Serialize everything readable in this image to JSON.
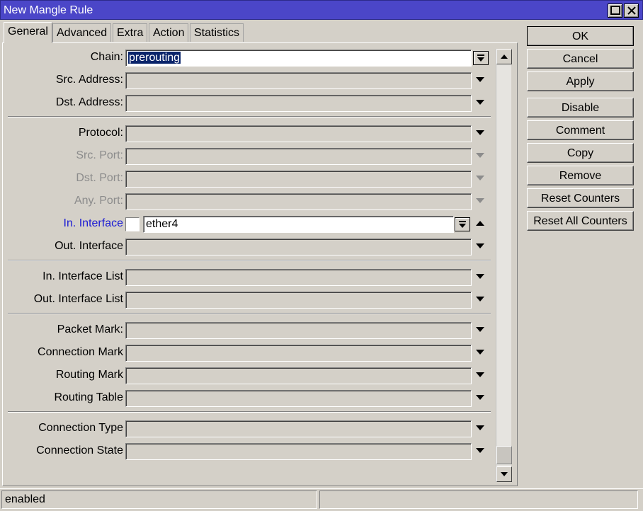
{
  "window": {
    "title": "New Mangle Rule"
  },
  "tabs": [
    {
      "label": "General",
      "active": true
    },
    {
      "label": "Advanced"
    },
    {
      "label": "Extra"
    },
    {
      "label": "Action"
    },
    {
      "label": "Statistics"
    }
  ],
  "fields": {
    "chain": {
      "label": "Chain:",
      "value": "prerouting"
    },
    "src_address": {
      "label": "Src. Address:",
      "value": ""
    },
    "dst_address": {
      "label": "Dst. Address:",
      "value": ""
    },
    "protocol": {
      "label": "Protocol:",
      "value": ""
    },
    "src_port": {
      "label": "Src. Port:",
      "value": ""
    },
    "dst_port": {
      "label": "Dst. Port:",
      "value": ""
    },
    "any_port": {
      "label": "Any. Port:",
      "value": ""
    },
    "in_interface": {
      "label": "In. Interface",
      "value": "ether4"
    },
    "out_interface": {
      "label": "Out. Interface",
      "value": ""
    },
    "in_interface_list": {
      "label": "In. Interface List",
      "value": ""
    },
    "out_interface_list": {
      "label": "Out. Interface List",
      "value": ""
    },
    "packet_mark": {
      "label": "Packet Mark:",
      "value": ""
    },
    "connection_mark": {
      "label": "Connection Mark",
      "value": ""
    },
    "routing_mark": {
      "label": "Routing Mark",
      "value": ""
    },
    "routing_table": {
      "label": "Routing Table",
      "value": ""
    },
    "connection_type": {
      "label": "Connection Type",
      "value": ""
    },
    "connection_state": {
      "label": "Connection State",
      "value": ""
    }
  },
  "buttons": {
    "ok": "OK",
    "cancel": "Cancel",
    "apply": "Apply",
    "disable": "Disable",
    "comment": "Comment",
    "copy": "Copy",
    "remove": "Remove",
    "reset_counters": "Reset Counters",
    "reset_all_counters": "Reset All Counters"
  },
  "status": {
    "left": "enabled",
    "right": ""
  },
  "colors": {
    "titlebar": "#4b46c8",
    "selection": "#0a246a",
    "link_label": "#1a1ad4",
    "window_bg": "#d4d0c8"
  }
}
